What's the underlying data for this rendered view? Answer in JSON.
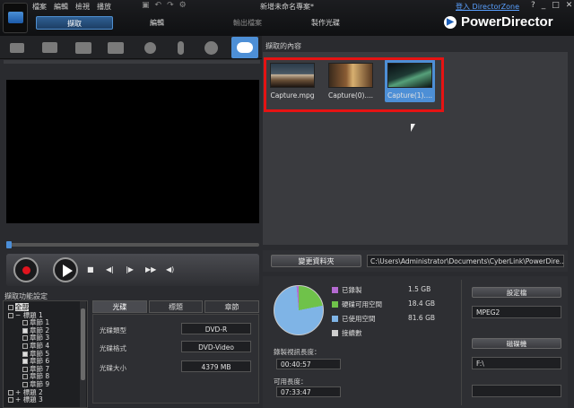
{
  "menu": [
    "檔案",
    "編輯",
    "檢視",
    "播放"
  ],
  "project_title": "新增未命名專案*",
  "directorzone": "登入 DirectorZone",
  "window_controls": [
    "?",
    "_",
    "□",
    "✕"
  ],
  "brand": "PowerDirector",
  "main_tabs": {
    "capture": "擷取",
    "edit": "編輯",
    "output": "輸出檔案",
    "disc": "製作光碟"
  },
  "capture_settings_label": "擷取功能設定",
  "tree": [
    {
      "label": "全部",
      "level": 0,
      "checked": false,
      "selected": true
    },
    {
      "label": "標題 1",
      "level": 0,
      "checked": false,
      "expand": "−"
    },
    {
      "label": "章節 1",
      "level": 1,
      "checked": false
    },
    {
      "label": "章節 2",
      "level": 1,
      "checked": true
    },
    {
      "label": "章節 3",
      "level": 1,
      "checked": false
    },
    {
      "label": "章節 4",
      "level": 1,
      "checked": false
    },
    {
      "label": "章節 5",
      "level": 1,
      "checked": true
    },
    {
      "label": "章節 6",
      "level": 1,
      "checked": true
    },
    {
      "label": "章節 7",
      "level": 1,
      "checked": false
    },
    {
      "label": "章節 8",
      "level": 1,
      "checked": false
    },
    {
      "label": "章節 9",
      "level": 1,
      "checked": false
    },
    {
      "label": "標題 2",
      "level": 0,
      "checked": false,
      "expand": "+"
    },
    {
      "label": "標題 3",
      "level": 0,
      "checked": false,
      "expand": "+"
    }
  ],
  "prop_tabs": {
    "disc": "光碟",
    "title": "標題",
    "chapter": "章節"
  },
  "props": [
    {
      "label": "光碟類型",
      "value": "DVD-R"
    },
    {
      "label": "光碟格式",
      "value": "DVD-Video"
    },
    {
      "label": "光碟大小",
      "value": "4379 MB"
    }
  ],
  "content_label": "擷取的內容",
  "clips": [
    {
      "name": "Capture.mpg"
    },
    {
      "name": "Capture(0)...."
    },
    {
      "name": "Capture(1)...."
    }
  ],
  "change_folder": "變更資料夾",
  "folder_path": "C:\\Users\\Administrator\\Documents\\CyberLink\\PowerDire...",
  "storage": [
    {
      "label": "已錄製",
      "value": "1.5 GB",
      "color": "#b46ad1"
    },
    {
      "label": "硬碟可用空間",
      "value": "18.4 GB",
      "color": "#6fc24a"
    },
    {
      "label": "已使用空間",
      "value": "81.6 GB",
      "color": "#7fb4e6"
    },
    {
      "label": "接續數",
      "value": "",
      "color": "#cfcfcf"
    }
  ],
  "rec_length_label": "錄製視訊長度：",
  "rec_length": "00:40:57",
  "avail_length_label": "可用長度：",
  "avail_length": "07:33:47",
  "profile_button": "設定檔",
  "profile_value": "MPEG2",
  "drive_button": "磁碟機",
  "drive_value": "F:\\"
}
